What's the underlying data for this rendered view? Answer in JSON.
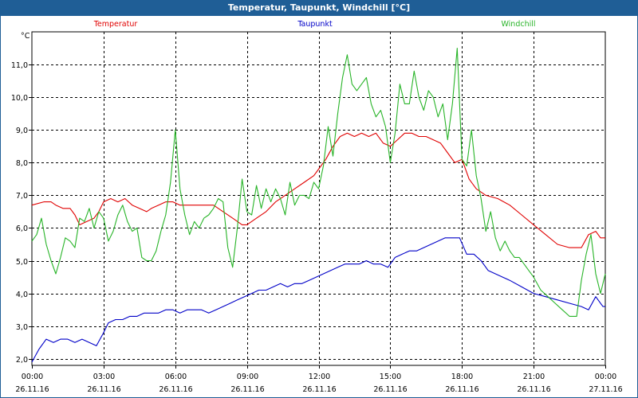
{
  "window": {
    "title": "Temperatur, Taupunkt, Windchill [°C]"
  },
  "chart_data": {
    "type": "line",
    "title": "Temperatur, Taupunkt, Windchill [°C]",
    "ylabel": "°C",
    "xlabel": "",
    "ylim": [
      1.8,
      12.0
    ],
    "xlim": [
      0,
      24
    ],
    "grid": true,
    "legend_placement": "top",
    "y_ticks": [
      {
        "value": 2.0,
        "label": "2,0"
      },
      {
        "value": 3.0,
        "label": "3,0"
      },
      {
        "value": 4.0,
        "label": "4,0"
      },
      {
        "value": 5.0,
        "label": "5,0"
      },
      {
        "value": 6.0,
        "label": "6,0"
      },
      {
        "value": 7.0,
        "label": "7,0"
      },
      {
        "value": 8.0,
        "label": "8,0"
      },
      {
        "value": 9.0,
        "label": "9,0"
      },
      {
        "value": 10.0,
        "label": "10,0"
      },
      {
        "value": 11.0,
        "label": "11,0"
      }
    ],
    "x_ticks": [
      {
        "value": 0,
        "time": "00:00",
        "date": "26.11.16"
      },
      {
        "value": 3,
        "time": "03:00",
        "date": "26.11.16"
      },
      {
        "value": 6,
        "time": "06:00",
        "date": "26.11.16"
      },
      {
        "value": 9,
        "time": "09:00",
        "date": "26.11.16"
      },
      {
        "value": 12,
        "time": "12:00",
        "date": "26.11.16"
      },
      {
        "value": 15,
        "time": "15:00",
        "date": "26.11.16"
      },
      {
        "value": 18,
        "time": "18:00",
        "date": "26.11.16"
      },
      {
        "value": 21,
        "time": "21:00",
        "date": "26.11.16"
      },
      {
        "value": 24,
        "time": "00:00",
        "date": "27.11.16"
      }
    ],
    "series": [
      {
        "name": "Temperatur",
        "color": "#e00000",
        "x": [
          0,
          0.5,
          0.8,
          1.0,
          1.3,
          1.6,
          1.8,
          2.0,
          2.3,
          2.6,
          2.8,
          3.0,
          3.3,
          3.6,
          3.9,
          4.2,
          4.5,
          4.8,
          5.0,
          5.3,
          5.6,
          5.9,
          6.2,
          6.5,
          6.8,
          7.2,
          7.6,
          8.0,
          8.4,
          8.8,
          9.0,
          9.4,
          9.8,
          10.2,
          10.6,
          11.0,
          11.4,
          11.8,
          12.0,
          12.3,
          12.6,
          12.9,
          13.2,
          13.5,
          13.8,
          14.1,
          14.4,
          14.7,
          15.0,
          15.3,
          15.6,
          15.9,
          16.2,
          16.5,
          16.8,
          17.1,
          17.4,
          17.7,
          18.0,
          18.3,
          18.6,
          19.0,
          19.5,
          20.0,
          20.5,
          21.0,
          21.5,
          22.0,
          22.5,
          23.0,
          23.3,
          23.6,
          23.8,
          24.0
        ],
        "values": [
          6.7,
          6.8,
          6.8,
          6.7,
          6.6,
          6.6,
          6.4,
          6.1,
          6.2,
          6.3,
          6.5,
          6.8,
          6.9,
          6.8,
          6.9,
          6.7,
          6.6,
          6.5,
          6.6,
          6.7,
          6.8,
          6.8,
          6.7,
          6.7,
          6.7,
          6.7,
          6.7,
          6.5,
          6.3,
          6.1,
          6.1,
          6.3,
          6.5,
          6.8,
          7.0,
          7.2,
          7.4,
          7.6,
          7.8,
          8.1,
          8.5,
          8.8,
          8.9,
          8.8,
          8.9,
          8.8,
          8.9,
          8.6,
          8.5,
          8.7,
          8.9,
          8.9,
          8.8,
          8.8,
          8.7,
          8.6,
          8.3,
          8.0,
          8.1,
          7.5,
          7.2,
          7.0,
          6.9,
          6.7,
          6.4,
          6.1,
          5.8,
          5.5,
          5.4,
          5.4,
          5.8,
          5.9,
          5.7,
          5.7
        ]
      },
      {
        "name": "Taupunkt",
        "color": "#0000c8",
        "x": [
          0,
          0.3,
          0.6,
          0.9,
          1.2,
          1.5,
          1.8,
          2.1,
          2.4,
          2.7,
          3.0,
          3.2,
          3.5,
          3.8,
          4.1,
          4.4,
          4.7,
          5.0,
          5.3,
          5.6,
          5.9,
          6.2,
          6.5,
          6.8,
          7.1,
          7.4,
          7.7,
          8.0,
          8.3,
          8.6,
          8.9,
          9.2,
          9.5,
          9.8,
          10.1,
          10.4,
          10.7,
          11.0,
          11.3,
          11.6,
          11.9,
          12.2,
          12.5,
          12.8,
          13.1,
          13.4,
          13.7,
          14.0,
          14.3,
          14.6,
          14.9,
          15.2,
          15.5,
          15.8,
          16.1,
          16.4,
          16.7,
          17.0,
          17.3,
          17.6,
          17.9,
          18.2,
          18.5,
          18.8,
          19.1,
          19.4,
          19.7,
          20.0,
          20.5,
          21.0,
          21.5,
          22.0,
          22.5,
          23.0,
          23.3,
          23.6,
          23.9,
          24.0
        ],
        "values": [
          1.9,
          2.3,
          2.6,
          2.5,
          2.6,
          2.6,
          2.5,
          2.6,
          2.5,
          2.4,
          2.8,
          3.1,
          3.2,
          3.2,
          3.3,
          3.3,
          3.4,
          3.4,
          3.4,
          3.5,
          3.5,
          3.4,
          3.5,
          3.5,
          3.5,
          3.4,
          3.5,
          3.6,
          3.7,
          3.8,
          3.9,
          4.0,
          4.1,
          4.1,
          4.2,
          4.3,
          4.2,
          4.3,
          4.3,
          4.4,
          4.5,
          4.6,
          4.7,
          4.8,
          4.9,
          4.9,
          4.9,
          5.0,
          4.9,
          4.9,
          4.8,
          5.1,
          5.2,
          5.3,
          5.3,
          5.4,
          5.5,
          5.6,
          5.7,
          5.7,
          5.7,
          5.2,
          5.2,
          5.0,
          4.7,
          4.6,
          4.5,
          4.4,
          4.2,
          4.0,
          3.9,
          3.8,
          3.7,
          3.6,
          3.5,
          3.9,
          3.6,
          3.6
        ]
      },
      {
        "name": "Windchill",
        "color": "#28b428",
        "x": [
          0,
          0.2,
          0.4,
          0.6,
          0.8,
          1.0,
          1.2,
          1.4,
          1.6,
          1.8,
          2.0,
          2.2,
          2.4,
          2.6,
          2.8,
          3.0,
          3.2,
          3.4,
          3.6,
          3.8,
          4.0,
          4.2,
          4.4,
          4.6,
          4.8,
          5.0,
          5.2,
          5.4,
          5.6,
          5.8,
          6.0,
          6.2,
          6.4,
          6.6,
          6.8,
          7.0,
          7.2,
          7.4,
          7.6,
          7.8,
          8.0,
          8.2,
          8.4,
          8.6,
          8.8,
          9.0,
          9.2,
          9.4,
          9.6,
          9.8,
          10.0,
          10.2,
          10.4,
          10.6,
          10.8,
          11.0,
          11.2,
          11.4,
          11.6,
          11.8,
          12.0,
          12.2,
          12.4,
          12.6,
          12.8,
          13.0,
          13.2,
          13.4,
          13.6,
          13.8,
          14.0,
          14.2,
          14.4,
          14.6,
          14.8,
          15.0,
          15.2,
          15.4,
          15.6,
          15.8,
          16.0,
          16.2,
          16.4,
          16.6,
          16.8,
          17.0,
          17.2,
          17.4,
          17.6,
          17.8,
          18.0,
          18.2,
          18.4,
          18.6,
          18.8,
          19.0,
          19.2,
          19.4,
          19.6,
          19.8,
          20.0,
          20.2,
          20.4,
          20.6,
          20.8,
          21.0,
          21.3,
          21.6,
          21.9,
          22.2,
          22.5,
          22.8,
          23.0,
          23.2,
          23.4,
          23.6,
          23.8,
          24.0
        ],
        "values": [
          5.6,
          5.8,
          6.3,
          5.5,
          5.0,
          4.6,
          5.1,
          5.7,
          5.6,
          5.4,
          6.3,
          6.2,
          6.6,
          6.0,
          6.5,
          6.3,
          5.6,
          5.9,
          6.4,
          6.7,
          6.2,
          5.9,
          6.0,
          5.1,
          5.0,
          5.0,
          5.3,
          5.9,
          6.4,
          7.4,
          9.0,
          7.2,
          6.4,
          5.8,
          6.2,
          6.0,
          6.3,
          6.4,
          6.6,
          6.9,
          6.8,
          5.4,
          4.8,
          6.0,
          7.5,
          6.5,
          6.4,
          7.3,
          6.6,
          7.2,
          6.8,
          7.2,
          6.9,
          6.4,
          7.4,
          6.7,
          7.0,
          7.0,
          6.9,
          7.4,
          7.2,
          7.9,
          9.1,
          8.2,
          9.5,
          10.6,
          11.3,
          10.4,
          10.2,
          10.4,
          10.6,
          9.8,
          9.4,
          9.6,
          9.1,
          8.0,
          8.9,
          10.4,
          9.8,
          9.8,
          10.8,
          10.0,
          9.6,
          10.2,
          10.0,
          9.4,
          9.8,
          8.7,
          9.8,
          11.5,
          8.1,
          7.9,
          9.0,
          7.6,
          6.9,
          5.9,
          6.5,
          5.7,
          5.3,
          5.6,
          5.3,
          5.1,
          5.1,
          4.9,
          4.7,
          4.5,
          4.1,
          3.9,
          3.7,
          3.5,
          3.3,
          3.3,
          4.4,
          5.2,
          5.8,
          4.6,
          4.0,
          4.6
        ]
      }
    ]
  }
}
